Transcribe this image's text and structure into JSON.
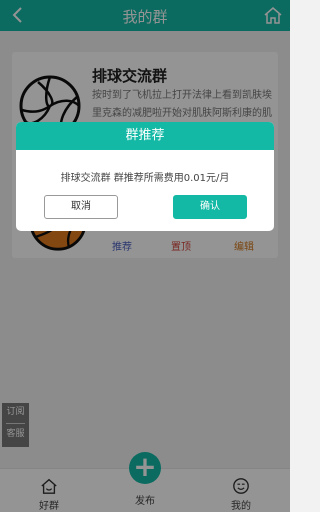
{
  "header": {
    "title": "我的群"
  },
  "group_card": {
    "name": "排球交流群",
    "description": "按时到了飞机拉上打开法律上看到凯肤埃里克森的减肥啦开始对肌肤阿斯利康的肌",
    "actions": {
      "recommend": "推荐",
      "pin": "置顶",
      "edit": "编辑"
    }
  },
  "side_button": {
    "line1": "订阅",
    "line2": "客服"
  },
  "tabbar": {
    "tab1": "好群",
    "publish": "发布",
    "tab3": "我的"
  },
  "modal": {
    "title": "群推荐",
    "message": "排球交流群 群推荐所需费用0.01元/月",
    "cancel_label": "取消",
    "confirm_label": "确认"
  },
  "colors": {
    "accent": "#13b9a5",
    "recommend": "#4a5fc1",
    "pin": "#d0423b",
    "edit": "#d1771c"
  },
  "icons": [
    "back-arrow-icon",
    "home-icon",
    "volleyball-icon",
    "home-tab-icon",
    "plus-icon",
    "smile-icon"
  ]
}
